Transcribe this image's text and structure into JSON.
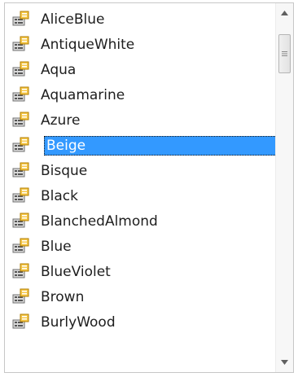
{
  "list": {
    "items": [
      {
        "label": "AliceBlue"
      },
      {
        "label": "AntiqueWhite"
      },
      {
        "label": "Aqua"
      },
      {
        "label": "Aquamarine"
      },
      {
        "label": "Azure"
      },
      {
        "label": "Beige"
      },
      {
        "label": "Bisque"
      },
      {
        "label": "Black"
      },
      {
        "label": "BlanchedAlmond"
      },
      {
        "label": "Blue"
      },
      {
        "label": "BlueViolet"
      },
      {
        "label": "Brown"
      },
      {
        "label": "BurlyWood"
      }
    ],
    "selected_index": 5,
    "item_icon": "property-icon"
  },
  "colors": {
    "selection": "#3399ff",
    "selection_text": "#ffffff",
    "text": "#1e1e1e"
  }
}
